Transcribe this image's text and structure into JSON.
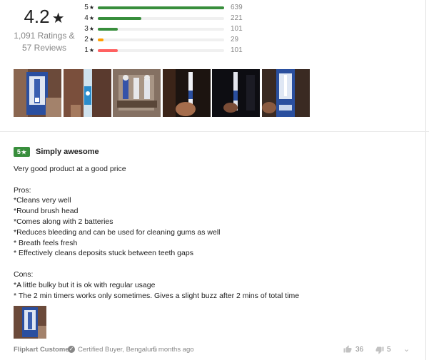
{
  "summary": {
    "average": "4.2",
    "star": "★",
    "ratings_line": "1,091 Ratings &",
    "reviews_line": "57 Reviews",
    "breakdown": [
      {
        "stars": "5",
        "count": "639",
        "fraction": 1.0,
        "color": "#388e3c"
      },
      {
        "stars": "4",
        "count": "221",
        "fraction": 0.346,
        "color": "#388e3c"
      },
      {
        "stars": "3",
        "count": "101",
        "fraction": 0.158,
        "color": "#388e3c"
      },
      {
        "stars": "2",
        "count": "29",
        "fraction": 0.045,
        "color": "#ff9f00"
      },
      {
        "stars": "1",
        "count": "101",
        "fraction": 0.158,
        "color": "#ff6161"
      }
    ]
  },
  "gallery": {
    "images": [
      {
        "name": "toothbrush-pack-photo"
      },
      {
        "name": "toothbrush-closeup-photo"
      },
      {
        "name": "brush-heads-photo"
      },
      {
        "name": "toothbrush-in-hand-photo"
      },
      {
        "name": "toothbrush-lit-photo"
      },
      {
        "name": "toothbrush-box-photo"
      }
    ]
  },
  "review": {
    "rating": "5",
    "star": "★",
    "title": "Simply awesome",
    "lines": [
      "Very good product at a good price",
      "",
      "Pros:",
      "*Cleans very well",
      "*Round brush head",
      "*Comes along with 2 batteries",
      "*Reduces bleeding and can be used for cleaning gums as well",
      "* Breath feels fresh",
      "* Effectively cleans deposits stuck between teeth gaps",
      "",
      "Cons:",
      "*A little bulky but it is ok with regular usage",
      "* The 2 min timers works only sometimes. Gives a slight buzz after 2 mins of total time"
    ],
    "author": "Flipkart Customer",
    "certified": "Certified Buyer, Bengaluru",
    "time": "5 months ago",
    "likes": "36",
    "dislikes": "5"
  },
  "colors": {
    "positive": "#388e3c",
    "average": "#ff9f00",
    "negative": "#ff6161",
    "muted_text": "#878787"
  },
  "icons": [
    "star-icon",
    "verified-check-icon",
    "thumbs-up-icon",
    "thumbs-down-icon",
    "chevron-down-icon"
  ]
}
